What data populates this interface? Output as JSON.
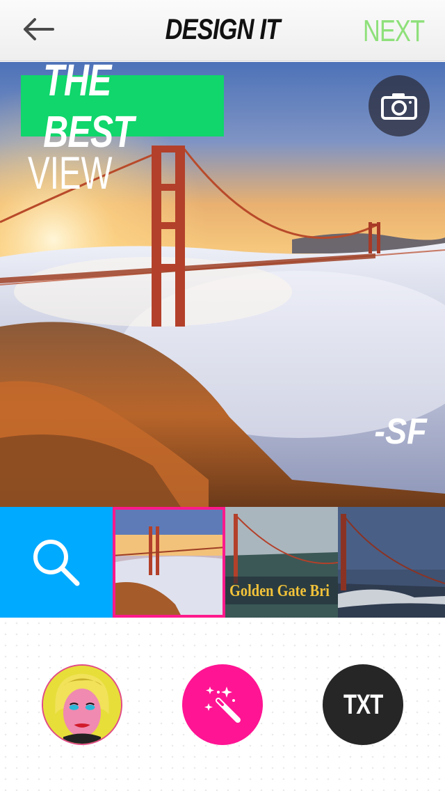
{
  "header": {
    "back_icon": "arrow-left-icon",
    "title": "DESIGN IT",
    "next_label": "NEXT",
    "next_color": "#8ee07a"
  },
  "canvas": {
    "caption_main": "THE BEST",
    "caption_main_bg": "#10d66b",
    "caption_sub": "VIEW",
    "signature": "-SF",
    "camera_icon": "camera-icon"
  },
  "strip": {
    "search_icon": "search-icon",
    "search_bg": "#00aaff",
    "selected_border": "#ff1a8c",
    "thumbs": [
      {
        "id": "thumb-1",
        "selected": true
      },
      {
        "id": "thumb-2",
        "caption": "Golden Gate Bri"
      },
      {
        "id": "thumb-3"
      }
    ]
  },
  "tools": {
    "pop_art_icon": "pop-art-portrait-icon",
    "magic_icon": "magic-wand-icon",
    "magic_bg": "#ff1493",
    "text_label": "TXT",
    "text_bg": "#262626"
  }
}
